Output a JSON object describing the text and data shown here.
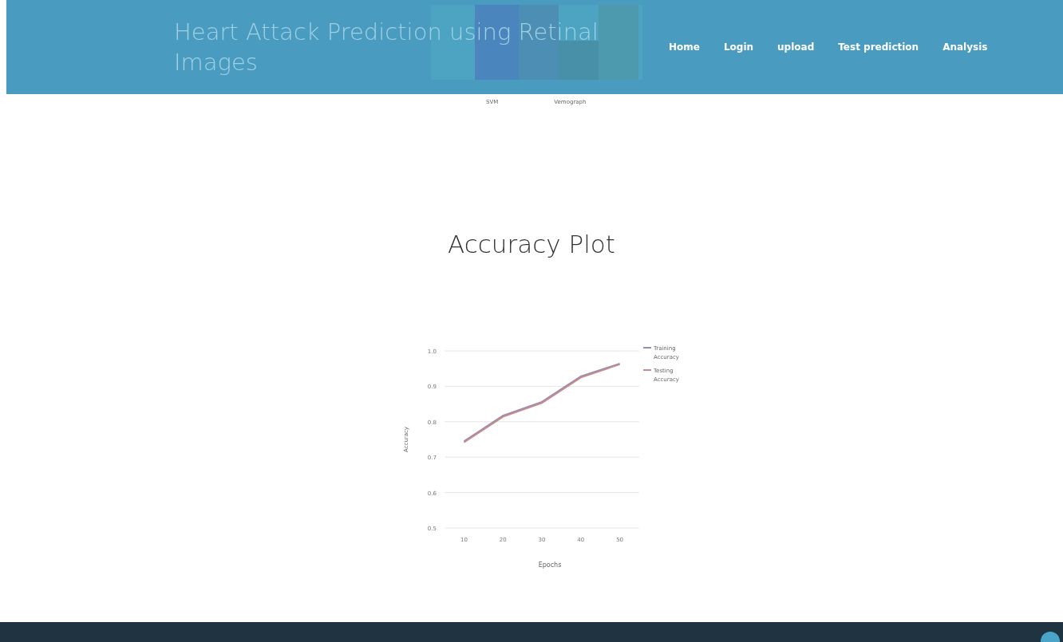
{
  "header": {
    "title": "Heart Attack Prediction using Retinal Images",
    "nav": [
      {
        "label": "Home"
      },
      {
        "label": "Login"
      },
      {
        "label": "upload"
      },
      {
        "label": "Test prediction"
      },
      {
        "label": "Analysis"
      }
    ]
  },
  "previous_chart_labels": [
    "SVM",
    "Vemograph"
  ],
  "section": {
    "title": "Accuracy Plot",
    "chart_data": {
      "type": "line",
      "xlabel": "Epochs",
      "ylabel": "Accuracy",
      "x": [
        10,
        20,
        30,
        40,
        50
      ],
      "xlim": [
        5,
        55
      ],
      "ylim": [
        0.5,
        1.0
      ],
      "grid": true,
      "legend": true,
      "yticks": [
        {
          "value": 1.0,
          "label": "1.0"
        },
        {
          "value": 0.9,
          "label": "0.9"
        },
        {
          "value": 0.8,
          "label": "0.8"
        },
        {
          "value": 0.7,
          "label": "0.7"
        },
        {
          "value": 0.6,
          "label": "0.6"
        },
        {
          "value": 0.5,
          "label": "0.5"
        }
      ],
      "xticks": [
        10,
        20,
        30,
        40,
        50
      ],
      "series": [
        {
          "name": "Training Accuracy",
          "color": "#8f8fb8",
          "values": [
            0.745,
            0.817,
            0.856,
            0.928,
            0.964
          ]
        },
        {
          "name": "Testing Accuracy",
          "color": "#c98a8a",
          "values": [
            0.742,
            0.814,
            0.853,
            0.925,
            0.962
          ]
        }
      ]
    }
  }
}
